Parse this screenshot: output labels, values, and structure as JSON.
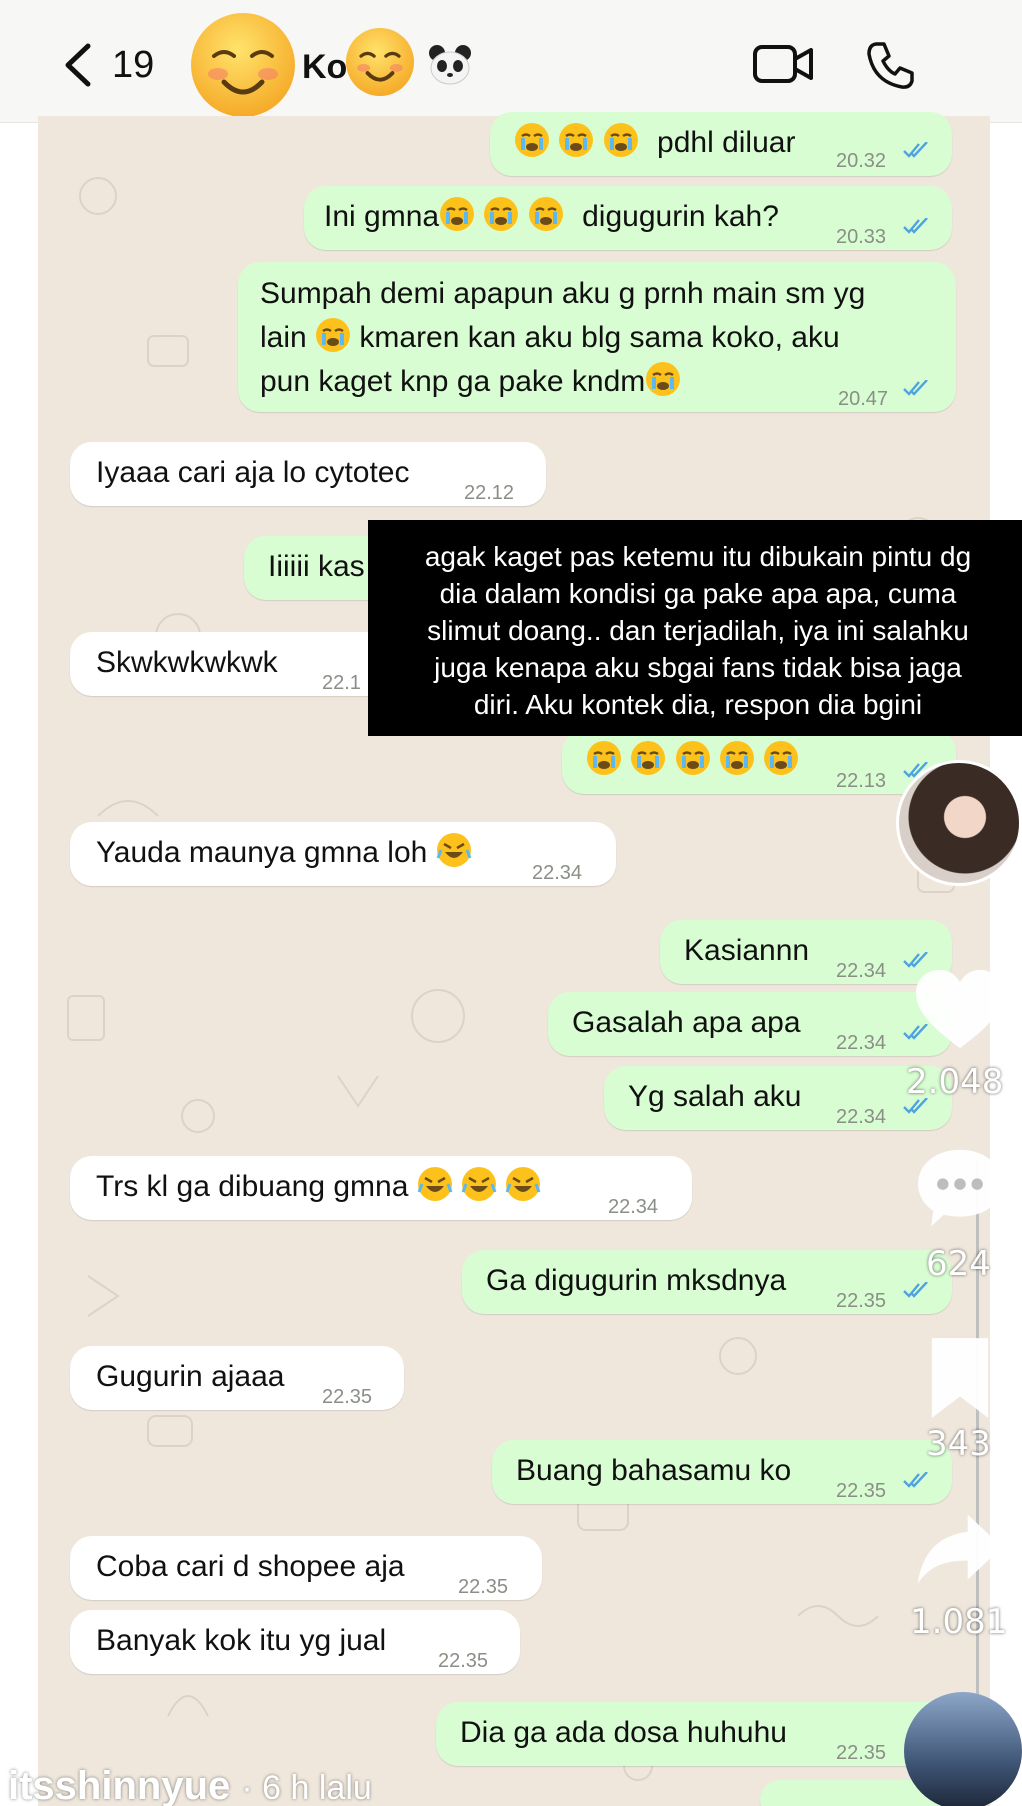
{
  "header": {
    "unread_count": "19",
    "contact_name": "Ko",
    "icons": [
      "back-chevron-icon",
      "smiling-face-emoji",
      "panda-emoji",
      "video-call-icon",
      "phone-call-icon"
    ]
  },
  "messages": [
    {
      "dir": "out",
      "text": "pdhl diluar",
      "time": "20.32"
    },
    {
      "dir": "out",
      "text_before": "Ini gmna",
      "text_after": "digugurin kah?",
      "time": "20.33"
    },
    {
      "dir": "out",
      "lines": [
        "Sumpah demi apapun aku g prnh main sm yg",
        "lain",
        "kmaren kan aku blg sama koko, aku",
        "pun kaget knp ga pake kndm"
      ],
      "time": "20.47"
    },
    {
      "dir": "in",
      "text": "Iyaaa cari aja lo cytotec",
      "time": "22.12"
    },
    {
      "dir": "out",
      "text": "Iiiiii kas"
    },
    {
      "dir": "in",
      "text": "Skwkwkwkwk",
      "time": "22.1"
    },
    {
      "dir": "out",
      "text": "",
      "time": "22.13"
    },
    {
      "dir": "in",
      "text": "Yauda maunya gmna loh",
      "time": "22.34"
    },
    {
      "dir": "out",
      "text": "Kasiannn",
      "time": "22.34"
    },
    {
      "dir": "out",
      "text": "Gasalah apa apa",
      "time": "22.34"
    },
    {
      "dir": "out",
      "text": "Yg salah aku",
      "time": "22.34"
    },
    {
      "dir": "in",
      "text": "Trs kl ga dibuang gmna",
      "time": "22.34"
    },
    {
      "dir": "out",
      "text": "Ga digugurin mksdnya",
      "time": "22.35"
    },
    {
      "dir": "in",
      "text": "Gugurin ajaaa",
      "time": "22.35"
    },
    {
      "dir": "out",
      "text": "Buang bahasamu ko",
      "time": "22.35"
    },
    {
      "dir": "in",
      "text": "Coba cari d shopee aja",
      "time": "22.35"
    },
    {
      "dir": "in",
      "text": "Banyak kok itu yg jual",
      "time": "22.35"
    },
    {
      "dir": "out",
      "text": "Dia ga ada dosa huhuhu",
      "time": "22.35"
    }
  ],
  "caption": {
    "lines": [
      "agak kaget pas ketemu itu dibukain pintu dg",
      "dia dalam kondisi ga pake apa apa, cuma",
      "slimut doang.. dan terjadilah, iya ini salahku",
      "juga kenapa aku sbgai fans tidak bisa jaga",
      "diri. Aku kontek dia, respon dia bgini"
    ]
  },
  "rail": {
    "likes": "2.048",
    "comments": "624",
    "saves": "343",
    "shares": "1.081"
  },
  "footer": {
    "username": "itsshinnyue",
    "age": "· 6 h lalu"
  },
  "colors": {
    "outgoing_bubble": "#d9fdd3",
    "incoming_bubble": "#ffffff",
    "chat_background": "#efe7dc",
    "read_ticks": "#4fa3e0"
  }
}
